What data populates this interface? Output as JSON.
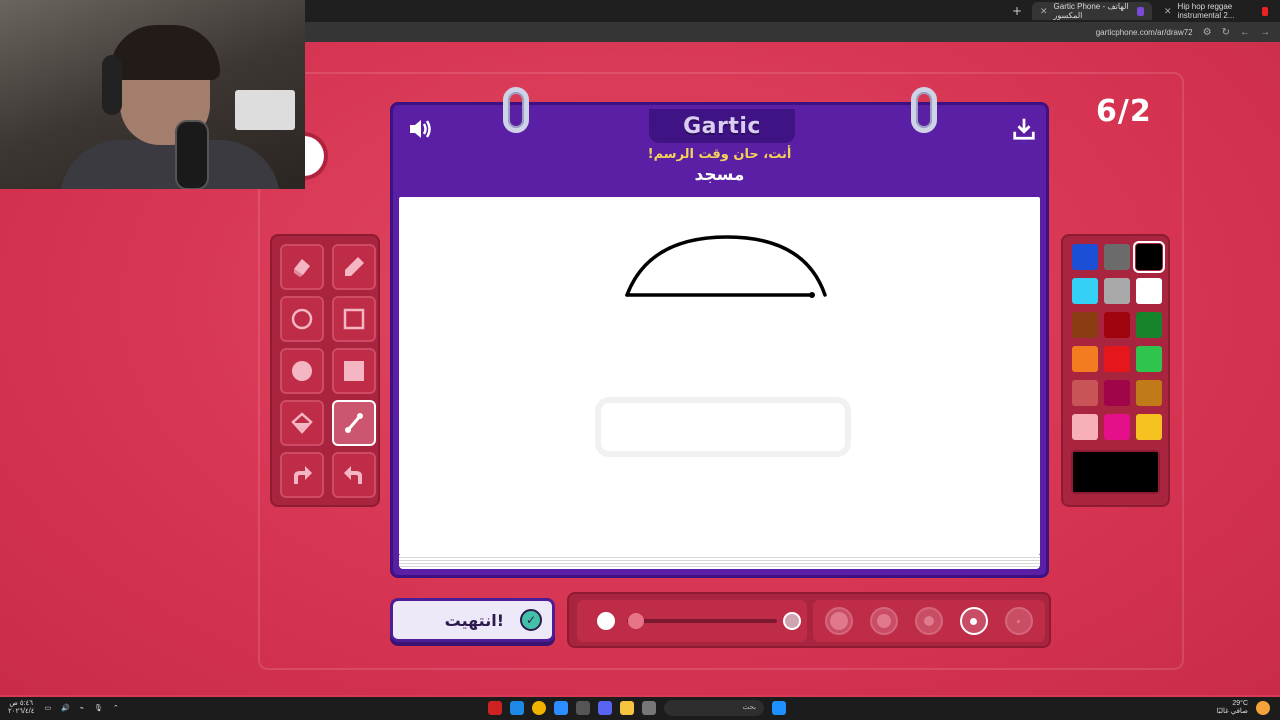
{
  "browser": {
    "tabs": [
      {
        "label": "Hip hop reggae instrumental 2...",
        "active": false
      },
      {
        "label": "Gartic Phone - الهاتف المكسور",
        "active": true
      }
    ],
    "url": "garticphone.com/ar/draw72"
  },
  "game": {
    "round": "6/2",
    "logo": "Gartic",
    "prompt_label": "أنت، حان وقت الرسم!",
    "prompt_word": "مسجد",
    "done_label": "انتهيت!",
    "current_color": "#000000",
    "selected_tool": "line-tool",
    "selected_size_index": 3
  },
  "tools": [
    {
      "name": "eraser-tool-icon"
    },
    {
      "name": "pencil-tool-icon"
    },
    {
      "name": "circle-outline-tool-icon"
    },
    {
      "name": "square-outline-tool-icon"
    },
    {
      "name": "circle-fill-tool-icon"
    },
    {
      "name": "square-fill-tool-icon"
    },
    {
      "name": "bucket-fill-tool-icon"
    },
    {
      "name": "line-tool-icon"
    },
    {
      "name": "redo-icon"
    },
    {
      "name": "undo-icon"
    }
  ],
  "palette": [
    "#1a4fd6",
    "#6b6b6b",
    "#000000",
    "#35d0f5",
    "#a9a9a9",
    "#ffffff",
    "#8a3d12",
    "#a0050f",
    "#17842c",
    "#f47c20",
    "#e5171c",
    "#2fc44c",
    "#c85458",
    "#a0054a",
    "#c07a18",
    "#f7b0b8",
    "#e50f8a",
    "#f6c21f"
  ],
  "taskbar": {
    "search_label": "بحث",
    "time": "٥:٤٦ ص",
    "date": "٢٠٢٦/٤/٤",
    "weather": "29°C",
    "weather_note": "صافي غالبًا"
  }
}
